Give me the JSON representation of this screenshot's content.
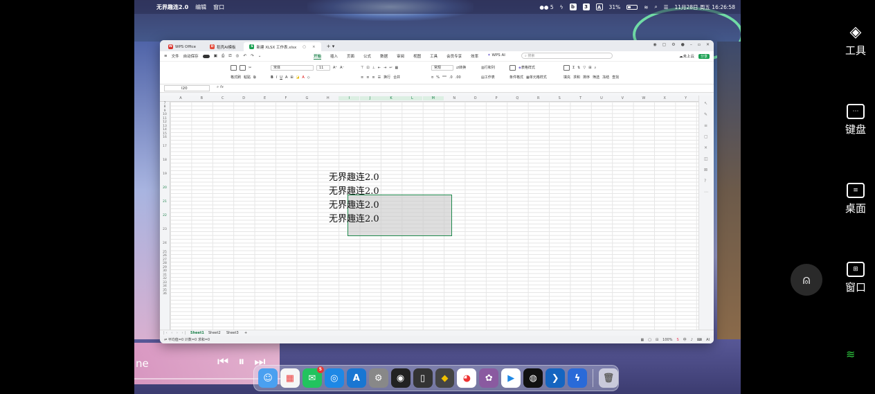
{
  "menubar": {
    "app_name": "无界趣连2.0",
    "menu_edit": "编辑",
    "menu_window": "窗口",
    "wechat_count": "5",
    "input_method": "A",
    "battery": "31%",
    "datetime": "11月28日 周五 16:26:58"
  },
  "wps": {
    "tabs": [
      {
        "label": "WPS Office",
        "icon_color": "#d9322b"
      },
      {
        "label": "稻壳AI模板",
        "icon_color": "#e34b3a"
      },
      {
        "label": "新建 XLSX 工作表.xlsx",
        "icon_color": "#1aa052"
      }
    ],
    "menu": {
      "file": "文件",
      "autosave": "自动保存",
      "tabs": [
        "开始",
        "插入",
        "页面",
        "公式",
        "数据",
        "审阅",
        "视图",
        "工具",
        "会员专享",
        "效率"
      ],
      "ai": "WPS AI",
      "search_placeholder": "搜索",
      "cloud": "未上云",
      "share": "分享"
    },
    "ribbon": {
      "format_painter": "格式刷",
      "paste": "粘贴",
      "font_name": "宋体",
      "font_size": "11",
      "number_format": "常规",
      "convert": "转换",
      "row_col": "行和列",
      "worksheet": "工作表",
      "cond_format": "条件格式",
      "cell_style": "单元格样式",
      "table_style": "表格样式",
      "fill": "填充",
      "sum": "求和",
      "sort": "排序",
      "filter": "筛选",
      "freeze": "冻结",
      "find": "查找",
      "wrap": "换行",
      "merge": "合并"
    },
    "name_box": "I20",
    "fx": "fx",
    "columns": [
      "A",
      "B",
      "C",
      "D",
      "E",
      "F",
      "G",
      "H",
      "I",
      "J",
      "K",
      "L",
      "M",
      "N",
      "O",
      "P",
      "Q",
      "R",
      "S",
      "T",
      "U",
      "V",
      "W",
      "X",
      "Y"
    ],
    "rows": [
      "7",
      "8",
      "9",
      "10",
      "11",
      "12",
      "13",
      "14",
      "15",
      "16",
      "17",
      "18",
      "19",
      "20",
      "21",
      "22",
      "23",
      "24",
      "25",
      "26",
      "27",
      "28",
      "29",
      "30",
      "31",
      "32",
      "33",
      "34",
      "35",
      "36"
    ],
    "cell_values": [
      "无界趣连2.0",
      "无界趣连2.0",
      "无界趣连2.0",
      "无界趣连2.0"
    ],
    "sheets": [
      "Sheet1",
      "Sheet2",
      "Sheet3"
    ],
    "status": {
      "average": "平均值=0",
      "count": "计数=0",
      "sum": "求和=0",
      "zoom": "100%"
    }
  },
  "media": {
    "text": "ne"
  },
  "dock": {
    "wechat_badge": "5"
  },
  "right_panel": {
    "tools": "工具",
    "keyboard": "键盘",
    "desktop": "桌面",
    "window": "窗口"
  }
}
